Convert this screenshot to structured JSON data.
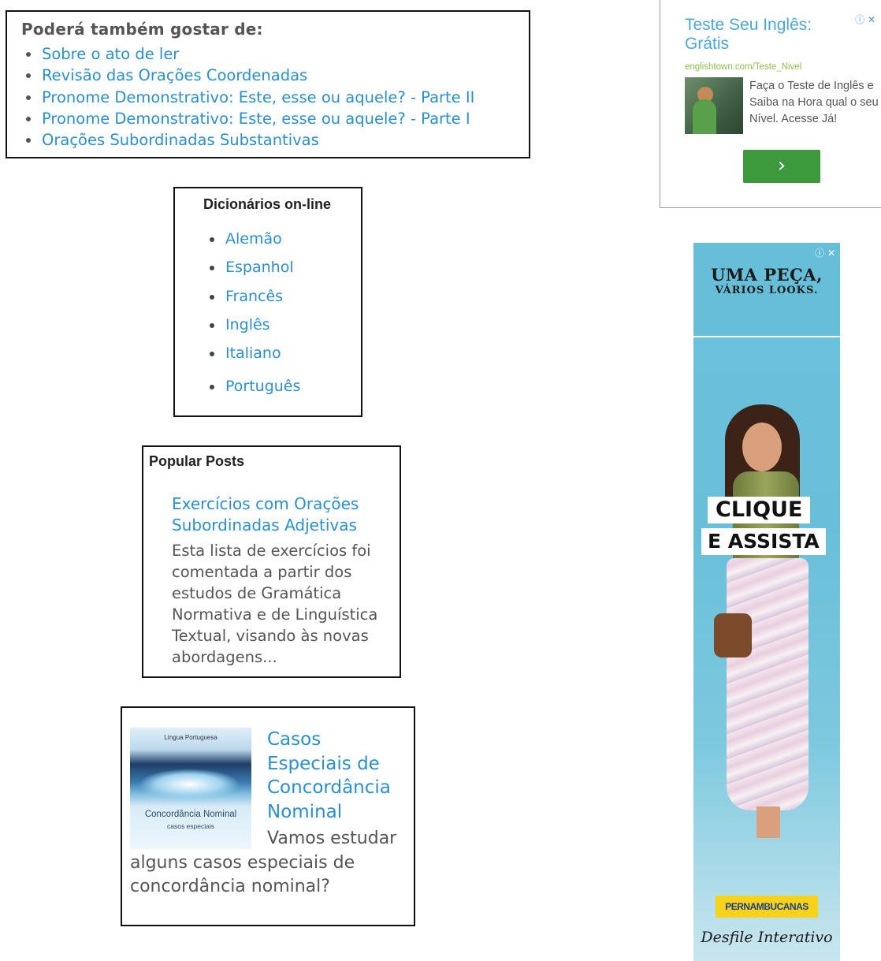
{
  "related": {
    "heading": "Poderá também gostar de:",
    "items": [
      "Sobre o ato de ler",
      "Revisão das Orações Coordenadas",
      "Pronome Demonstrativo: Este, esse ou aquele? - Parte II",
      "Pronome Demonstrativo: Este, esse ou aquele? - Parte I",
      "Orações Subordinadas Substantivas"
    ]
  },
  "dictionaries": {
    "heading": "Dicionários on-line",
    "items": [
      "Alemão",
      "Espanhol",
      "Francês",
      "Inglês",
      "Italiano",
      "Português"
    ]
  },
  "popular_posts": {
    "heading": "Popular Posts",
    "post_title": "Exercícios com Orações Subordinadas Adjetivas",
    "post_snippet": "Esta lista de exercícios foi comentada a partir dos estudos de Gramática Normativa e de Linguística Textual, visando às novas abordagens..."
  },
  "featured": {
    "thumb_top": "Língua Portuguesa",
    "thumb_title": "Concordância Nominal",
    "thumb_sub": "casos especiais",
    "title": "Casos Especiais de Concordância Nominal",
    "snippet": "Vamos estudar alguns casos especiais de concordância nominal?"
  },
  "ad1": {
    "title": "Teste Seu Inglês: Grátis",
    "url": "englishtown.com/Teste_Nivel",
    "body": "Faça o Teste de Inglês e Saiba na Hora qual o seu Nível. Acesse Já!",
    "button_icon": "chevron-right-icon",
    "colors": {
      "title": "#4aa7d8",
      "url": "#8bc34a",
      "button": "#3c9a3c"
    }
  },
  "ad2": {
    "headline": "UMA PEÇA,",
    "subheadline": "VÁRIOS LOOKS.",
    "cta_line1": "CLIQUE",
    "cta_line2": "E ASSISTA",
    "brand": "PERNAMBUCANAS",
    "footer": "Desfile Interativo"
  },
  "colors": {
    "link": "#2a8fd0",
    "text": "#555555",
    "border": "#111111"
  }
}
